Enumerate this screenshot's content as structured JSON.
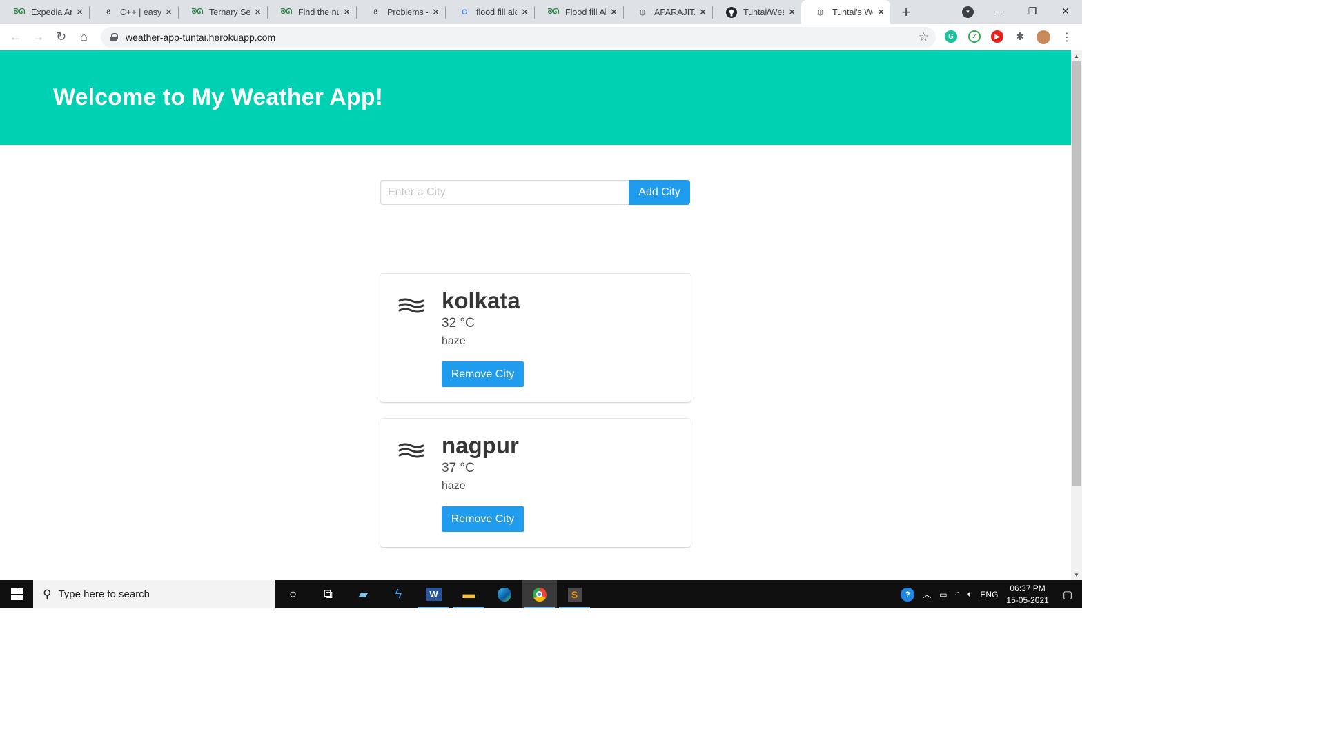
{
  "browser": {
    "tabs": [
      {
        "title": "Expedia Ar",
        "icon": "gfg-icon",
        "active": false
      },
      {
        "title": "C++ | easy",
        "icon": "leetcode-icon",
        "active": false
      },
      {
        "title": "Ternary Sea",
        "icon": "gfg-icon",
        "active": false
      },
      {
        "title": "Find the nu",
        "icon": "gfg-icon",
        "active": false
      },
      {
        "title": "Problems -",
        "icon": "leetcode-icon",
        "active": false
      },
      {
        "title": "flood fill alc",
        "icon": "google-icon",
        "active": false
      },
      {
        "title": "Flood fill Al",
        "icon": "gfg-icon",
        "active": false
      },
      {
        "title": "APARAJITA",
        "icon": "globe-icon",
        "active": false
      },
      {
        "title": "Tuntai/Wea",
        "icon": "github-icon",
        "active": false
      },
      {
        "title": "Tuntai's We",
        "icon": "globe-icon",
        "active": true
      }
    ],
    "url": "weather-app-tuntai.herokuapp.com"
  },
  "page": {
    "header_title": "Welcome to My Weather App!",
    "search": {
      "placeholder": "Enter a City",
      "value": "",
      "add_label": "Add City"
    },
    "cities": [
      {
        "name": "kolkata",
        "temp": "32 °C",
        "description": "haze",
        "icon": "haze-icon",
        "remove_label": "Remove City"
      },
      {
        "name": "nagpur",
        "temp": "37 °C",
        "description": "haze",
        "icon": "haze-icon",
        "remove_label": "Remove City"
      }
    ]
  },
  "taskbar": {
    "search_placeholder": "Type here to search",
    "language": "ENG",
    "time": "06:37 PM",
    "date": "15-05-2021"
  },
  "colors": {
    "hero": "#00d1b2",
    "button": "#209cee"
  }
}
